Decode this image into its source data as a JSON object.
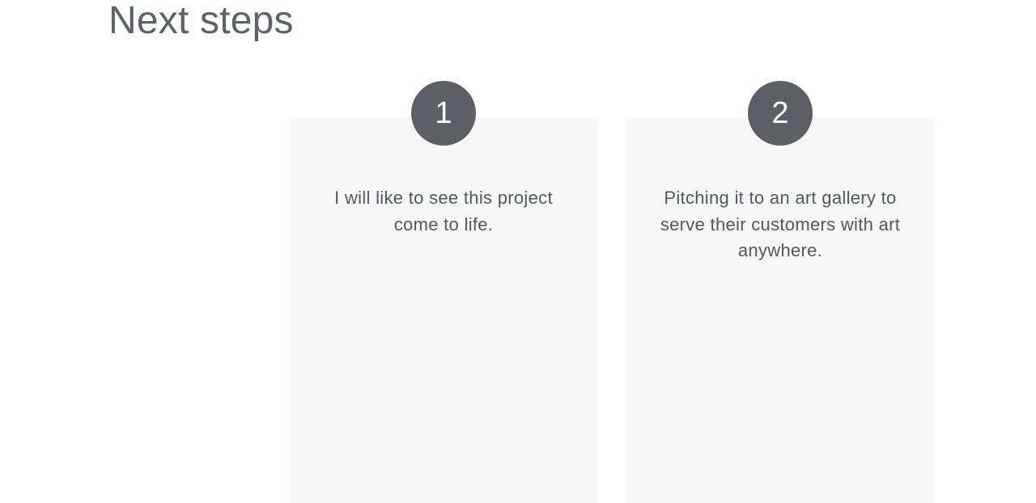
{
  "title": "Next steps",
  "steps": [
    {
      "number": "1",
      "text": "I will like to see this project come to life."
    },
    {
      "number": "2",
      "text": "Pitching it to an art gallery to serve their customers with art anywhere."
    }
  ],
  "colors": {
    "title": "#5f6169",
    "card_background": "#f7f7f7",
    "circle": "#5d5f66",
    "body_text": "#55575e"
  }
}
